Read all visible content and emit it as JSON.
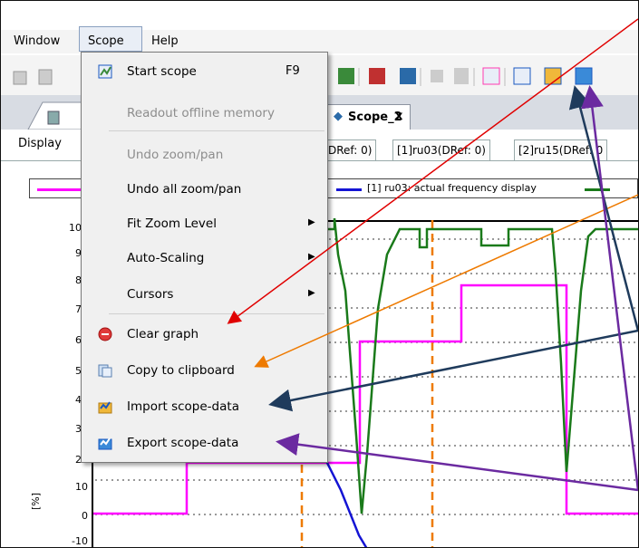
{
  "menubar": {
    "window": "Window",
    "scope": "Scope",
    "help": "Help"
  },
  "menu": {
    "start_scope": "Start scope",
    "start_scope_shortcut": "F9",
    "readout": "Readout offline memory",
    "undo_zoom": "Undo zoom/pan",
    "undo_all_zoom": "Undo all zoom/pan",
    "fit_zoom": "Fit Zoom Level",
    "auto_scaling": "Auto-Scaling",
    "cursors": "Cursors",
    "clear_graph": "Clear graph",
    "copy_clipboard": "Copy to clipboard",
    "import_data": "Import scope-data",
    "export_data": "Export scope-data"
  },
  "tabs": {
    "scope2": "Scope_2",
    "close": "x"
  },
  "subtabs": {
    "display": "Display",
    "ref0": "DRef: 0)",
    "ref1": "[1]ru03(DRef: 0)",
    "ref2": "[2]ru15(DRef: 0"
  },
  "legend": {
    "item1": "[1] ru03: actual frequency display"
  },
  "axis": {
    "y_unit": "[%]",
    "ticks": [
      "100",
      "90",
      "80",
      "70",
      "60",
      "50",
      "40",
      "30",
      "20",
      "10",
      "0",
      "-10"
    ]
  },
  "colors": {
    "magenta": "#ff00ff",
    "blue": "#1414d4",
    "green": "#1a7a1a",
    "orange": "#ee7a00",
    "red": "#e00000",
    "navy": "#1f3b5c",
    "purple": "#6b2aa0"
  }
}
